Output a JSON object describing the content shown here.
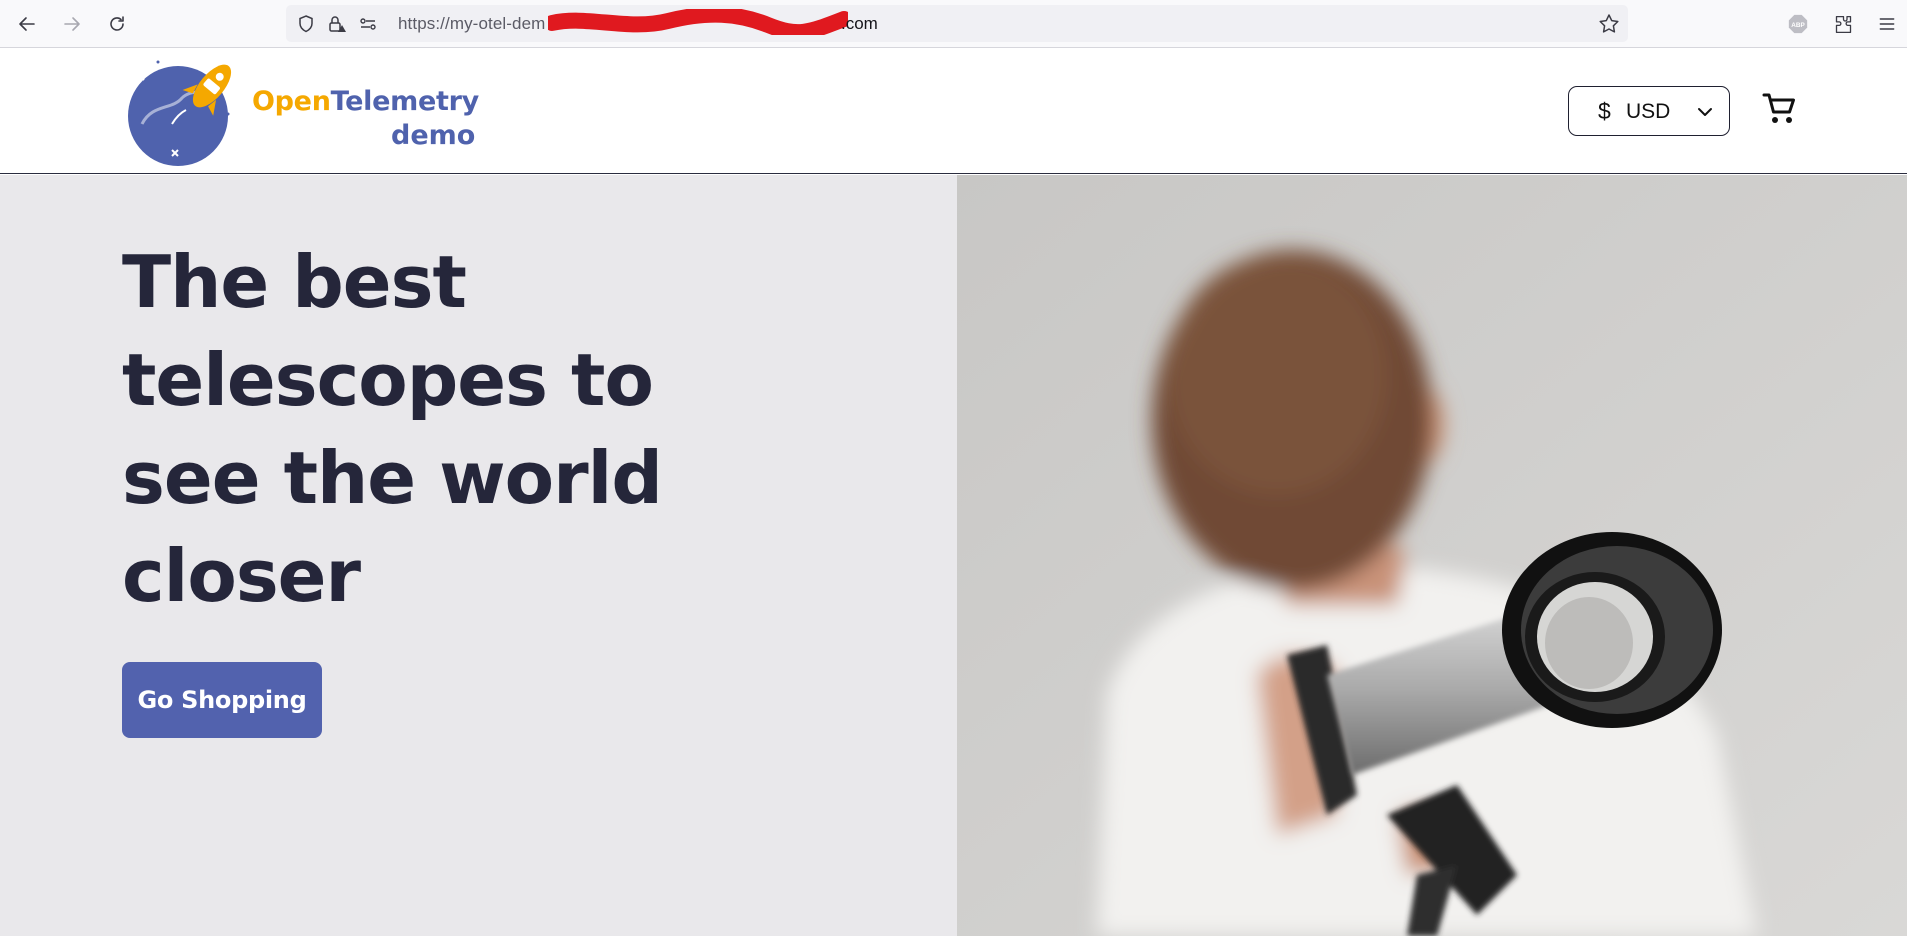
{
  "browser": {
    "url_visible_start": "https://my-otel-dem",
    "url_visible_end": ".com",
    "icons": [
      "back-arrow-icon",
      "forward-arrow-icon",
      "reload-icon",
      "shield-icon",
      "lock-warning-icon",
      "permissions-icon",
      "bookmark-star-icon",
      "adblock-icon",
      "extensions-icon",
      "menu-icon"
    ]
  },
  "header": {
    "logo": {
      "open": "Open",
      "telemetry": "Telemetry",
      "demo": "demo"
    },
    "currency": {
      "symbol": "$",
      "code": "USD"
    },
    "cart_icon": "cart-icon"
  },
  "hero": {
    "title": "The best telescopes to see the world closer",
    "cta_label": "Go Shopping"
  },
  "colors": {
    "brand_blue": "#4f62ad",
    "brand_orange": "#f5a800",
    "hero_bg": "#e9e8eb",
    "title_color": "#25263a",
    "button_bg": "#5262ae"
  }
}
